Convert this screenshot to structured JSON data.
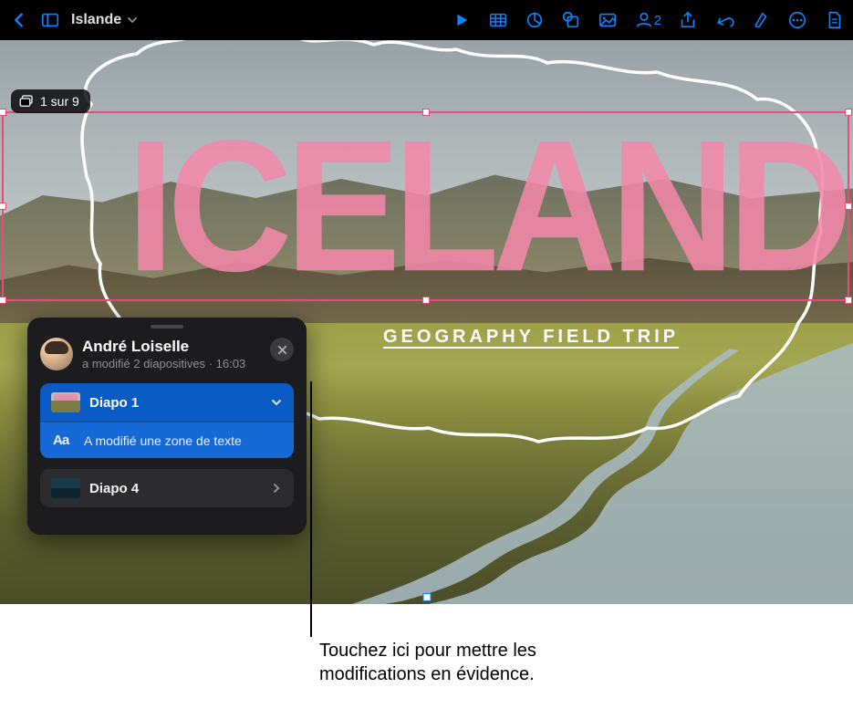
{
  "toolbar": {
    "doc_title": "Islande",
    "collab_count": "2"
  },
  "slide_counter": "1 sur 9",
  "slide": {
    "hero_title": "ICELAND",
    "subtitle": "GEOGRAPHY FIELD TRIP"
  },
  "activity": {
    "author_name": "André Loiselle",
    "author_sub": "a modifié 2 diapositives · 16:03",
    "groups": [
      {
        "label": "Diapo 1",
        "expanded": true,
        "selected": true,
        "changes": [
          {
            "icon": "Aa",
            "text": "A modifié une zone de texte"
          }
        ]
      },
      {
        "label": "Diapo 4",
        "expanded": false,
        "selected": false,
        "changes": []
      }
    ]
  },
  "callout": {
    "line1": "Touchez ici pour mettre les",
    "line2": "modifications en évidence."
  }
}
